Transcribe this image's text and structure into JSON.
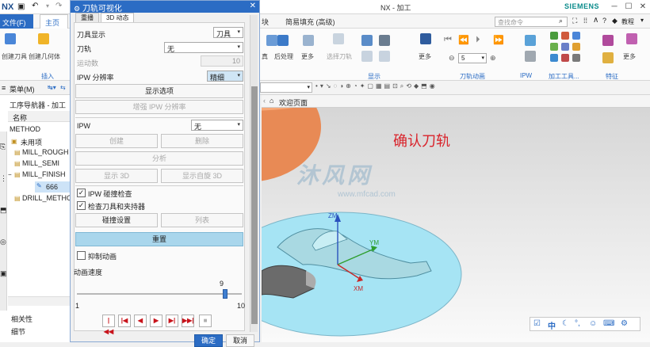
{
  "app": {
    "logo": "NX",
    "window_title": "NX - 加工",
    "brand": "SIEMENS",
    "search_placeholder": "查找命令",
    "help_label": "教程"
  },
  "menubar": {
    "file": "文件(F)",
    "home": "主页",
    "tab_partial": "块",
    "tab_fill": "简易填充 (高级)"
  },
  "ribbon": {
    "create_tool": "创建刀具",
    "create_geometry": "创建几何体",
    "insert_group": "插入",
    "machine_label": "真",
    "postprocess": "后处理",
    "more1": "更多",
    "select_tool": "选择刀轨",
    "more2": "更多",
    "display_group": "显示",
    "animation_group": "刀轨动画",
    "speed_value": "5",
    "ipw_group": "IPW",
    "machining_tools_group": "加工工具...",
    "feature_group": "特征",
    "more3": "更多",
    "more4": "更多"
  },
  "toolbar2": {
    "menu_label": "菜单(M)",
    "welcome": "欢迎页面"
  },
  "navigator": {
    "title": "工序导航器 - 加工",
    "column_name": "名称",
    "root": "METHOD",
    "items": [
      "未用项",
      "MILL_ROUGH",
      "MILL_SEMI",
      "MILL_FINISH",
      "666",
      "DRILL_METHOD"
    ],
    "bottom_items": [
      "相关性",
      "细节"
    ]
  },
  "dialog": {
    "title": "刀轨可视化",
    "tabs": [
      "重播",
      "3D 动态"
    ],
    "tool_display_label": "刀具显示",
    "tool_display_value": "刀具",
    "toolpath_label": "刀轨",
    "toolpath_value": "无",
    "motion_count_label": "运动数",
    "motion_count_value": "10",
    "ipw_resolution_label": "IPW 分辨率",
    "ipw_resolution_value": "精细",
    "display_options": "显示选项",
    "enhance_ipw": "增强 IPW 分辨率",
    "ipw_label": "IPW",
    "ipw_value": "无",
    "create": "创建",
    "delete": "删除",
    "analyze": "分析",
    "show_3d": "显示 3D",
    "show_own_3d": "显示自旋 3D",
    "ipw_collision_check": "IPW 碰撞检查",
    "check_tool_holder": "检查刀具和夹持器",
    "collision_settings": "碰撞设置",
    "list": "列表",
    "reset": "重置",
    "suppress_animation": "抑制动画",
    "anim_speed_label": "动画速度",
    "speed_min": "1",
    "speed_max": "10",
    "speed_current": "9",
    "speed_fraction": 0.9,
    "ok": "确定",
    "cancel": "取消"
  },
  "viewport": {
    "annotation": "确认刀轨",
    "watermark": "沐风网",
    "watermark_url": "www.mfcad.com",
    "axis_zm": "ZM",
    "axis_ym": "YM",
    "axis_xm": "XM",
    "ime_label": "中"
  },
  "colors": {
    "accent": "#2b6cc4",
    "annotation": "#d9222a",
    "base_disc": "#a6e4f4",
    "stock": "#e88a55",
    "part": "#a9d9e2"
  }
}
